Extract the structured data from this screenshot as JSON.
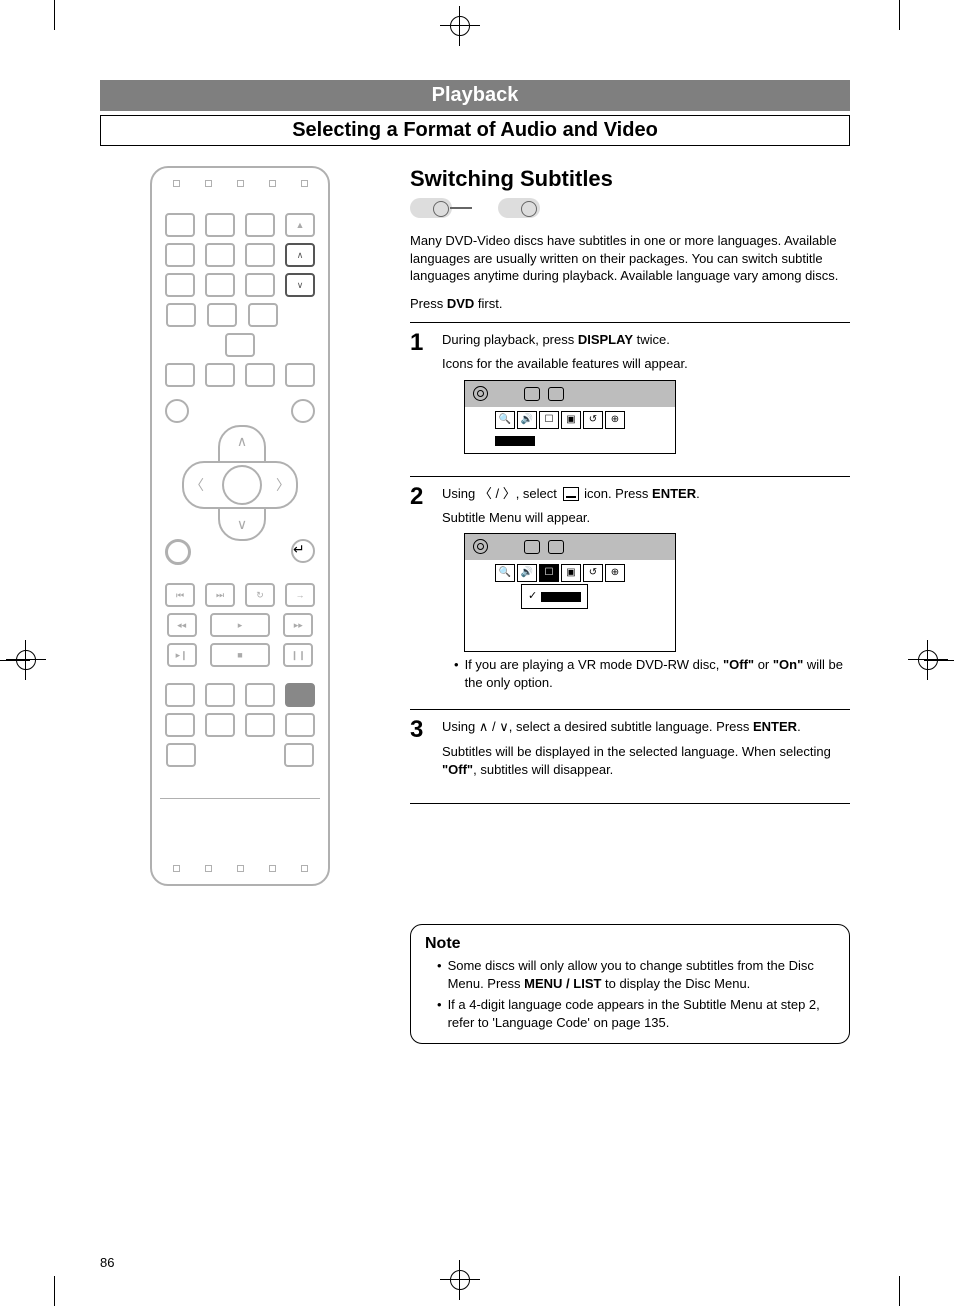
{
  "chapter": "Playback",
  "section": "Selecting a Format of Audio and Video",
  "topic": "Switching Subtitles",
  "intro": "Many DVD-Video discs have subtitles in one or more languages.  Available languages are usually written on their packages. You can switch subtitle languages anytime during playback.  Available language vary among discs.",
  "pre_step_prefix": "Press ",
  "pre_step_bold": "DVD",
  "pre_step_suffix": " first.",
  "steps": {
    "s1": {
      "num": "1",
      "line1_a": "During playback, press ",
      "line1_bold": "DISPLAY",
      "line1_b": " twice.",
      "line2": "Icons for the available features will appear."
    },
    "s2": {
      "num": "2",
      "line1_a": "Using ",
      "line1_sym": "〈 / 〉",
      "line1_b": ", select ",
      "line1_c": " icon.  Press ",
      "line1_bold": "ENTER",
      "line1_d": ".",
      "line2": "Subtitle Menu will appear.",
      "bullet_a": "If you are playing a VR mode DVD-RW disc, ",
      "bullet_bold1": "\"Off\"",
      "bullet_mid": " or ",
      "bullet_bold2": "\"On\"",
      "bullet_b": " will be the only option."
    },
    "s3": {
      "num": "3",
      "line1_a": "Using ",
      "line1_sym": "∧ / ∨",
      "line1_b": ", select a desired subtitle language. Press ",
      "line1_bold": "ENTER",
      "line1_c": ".",
      "line2_a": "Subtitles will be displayed in the selected language. When selecting ",
      "line2_bold": "\"Off\"",
      "line2_b": ", subtitles will disappear."
    }
  },
  "note": {
    "title": "Note",
    "n1_a": "Some discs will only allow you to change subtitles from the Disc Menu.  Press ",
    "n1_bold": "MENU / LIST",
    "n1_b": " to display the Disc Menu.",
    "n2": "If a 4-digit language code appears in the Subtitle Menu at step 2, refer to 'Language Code' on page 135."
  },
  "page_number": "86"
}
